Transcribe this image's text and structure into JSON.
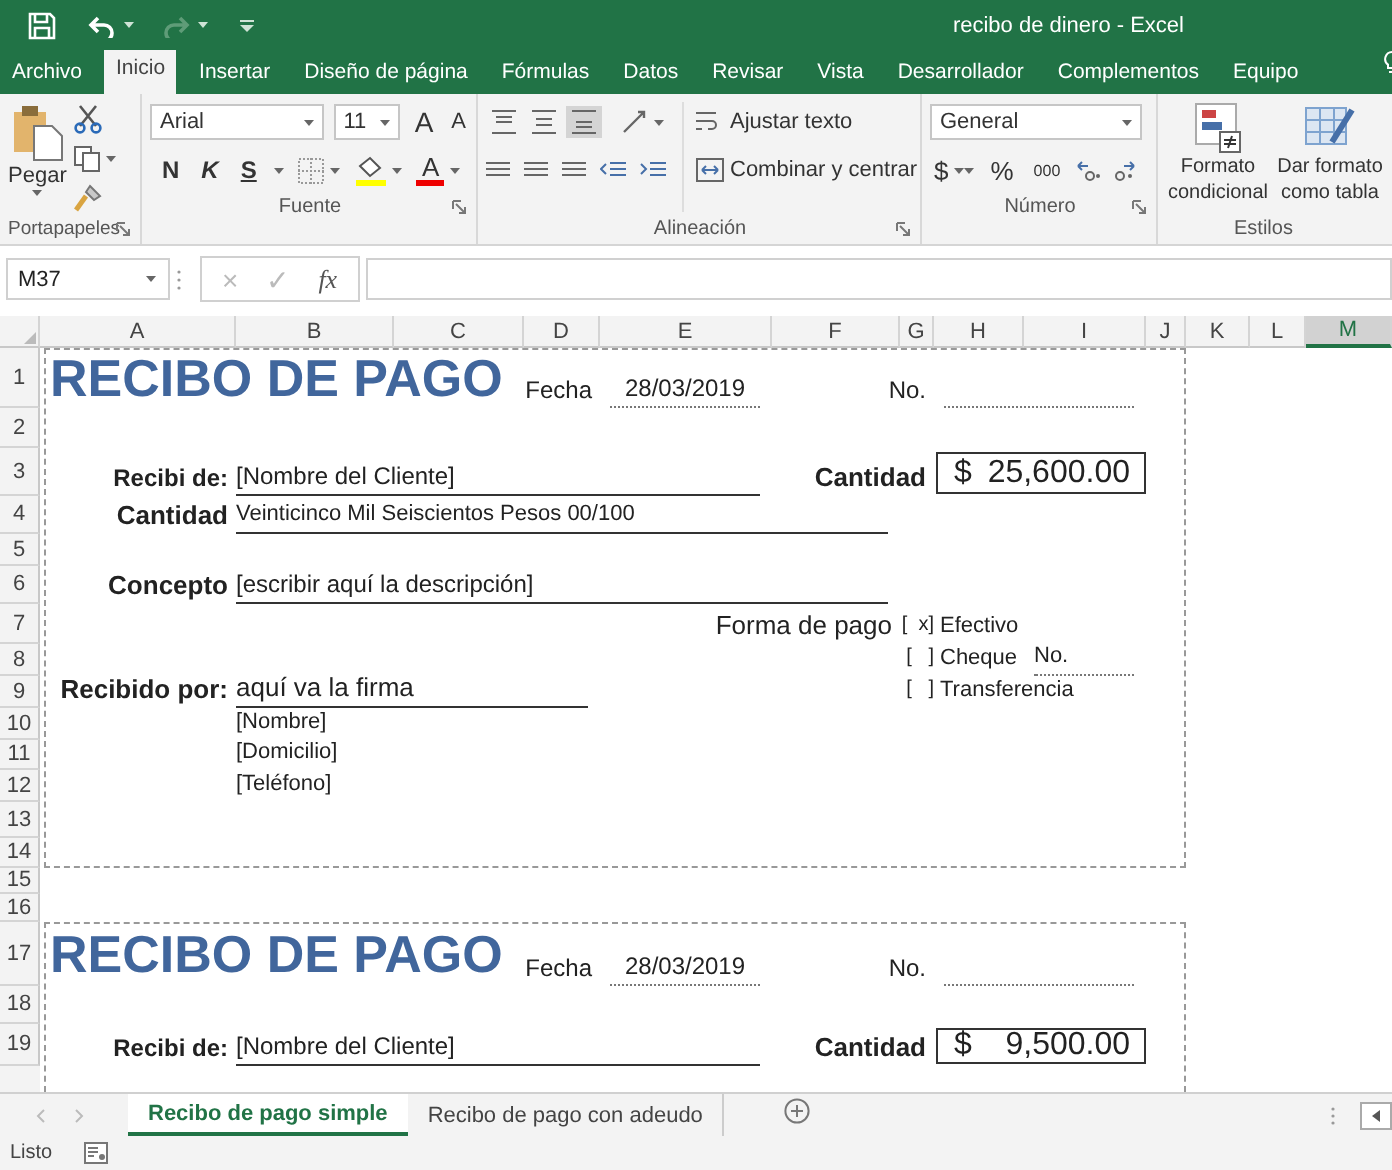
{
  "window": {
    "title": "recibo de dinero - Excel"
  },
  "menu_tabs": [
    {
      "label": "Archivo",
      "selected": false
    },
    {
      "label": "Inicio",
      "selected": true
    },
    {
      "label": "Insertar",
      "selected": false
    },
    {
      "label": "Diseño de página",
      "selected": false
    },
    {
      "label": "Fórmulas",
      "selected": false
    },
    {
      "label": "Datos",
      "selected": false
    },
    {
      "label": "Revisar",
      "selected": false
    },
    {
      "label": "Vista",
      "selected": false
    },
    {
      "label": "Desarrollador",
      "selected": false
    },
    {
      "label": "Complementos",
      "selected": false
    },
    {
      "label": "Equipo",
      "selected": false
    }
  ],
  "ribbon": {
    "clipboard": {
      "paste": "Pegar",
      "group": "Portapapeles"
    },
    "font": {
      "name": "Arial",
      "size": "11",
      "grow": "A",
      "shrink": "A",
      "styles": [
        "N",
        "K",
        "S"
      ],
      "font_color": "A",
      "group": "Fuente"
    },
    "alignment": {
      "vertical_align": [
        {
          "selected": false
        },
        {
          "selected": false
        },
        {
          "selected": true
        }
      ],
      "wrap": "Ajustar texto",
      "merge": "Combinar y centrar",
      "group": "Alineación"
    },
    "number": {
      "format": "General",
      "currency": "$",
      "percent": "%",
      "thousands": "000",
      "group": "Número"
    },
    "styles": {
      "buttons": [
        "Formato condicional",
        "Dar formato como tabla"
      ],
      "group": "Estilos"
    }
  },
  "formula_bar": {
    "name_box": "M37",
    "cancel": "×",
    "enter": "✓",
    "function": "fx"
  },
  "columns": [
    {
      "label": "A",
      "selected": false
    },
    {
      "label": "B",
      "selected": false
    },
    {
      "label": "C",
      "selected": false
    },
    {
      "label": "D",
      "selected": false
    },
    {
      "label": "E",
      "selected": false
    },
    {
      "label": "F",
      "selected": false
    },
    {
      "label": "G",
      "selected": false
    },
    {
      "label": "H",
      "selected": false
    },
    {
      "label": "I",
      "selected": false
    },
    {
      "label": "J",
      "selected": false
    },
    {
      "label": "K",
      "selected": false
    },
    {
      "label": "L",
      "selected": false
    },
    {
      "label": "M",
      "selected": true
    }
  ],
  "rows": [
    "1",
    "2",
    "3",
    "4",
    "5",
    "6",
    "7",
    "8",
    "9",
    "10",
    "11",
    "12",
    "13",
    "14",
    "15",
    "16",
    "17",
    "18",
    "19"
  ],
  "receipts": [
    {
      "title": "RECIBO DE PAGO",
      "date_label": "Fecha",
      "date": "28/03/2019",
      "number_label": "No.",
      "from_label": "Recibi de:",
      "from": "[Nombre del Cliente]",
      "amount_label": "Cantidad",
      "currency": "$",
      "amount": "25,600.00",
      "words_label": "Cantidad",
      "words": "Veinticinco Mil Seiscientos Pesos 00/100",
      "concept_label": "Concepto",
      "concept": "[escribir aquí la descripción]",
      "payment_label": "Forma de pago",
      "payment_options": [
        {
          "box": "[  x]",
          "label": "Efectivo"
        },
        {
          "box": "[   ]",
          "label": "Cheque",
          "field_label": "No."
        },
        {
          "box": "[   ]",
          "label": "Transferencia"
        }
      ],
      "received_label": "Recibido por:",
      "signature": "aquí va la firma",
      "details": [
        "[Nombre]",
        "[Domicilio]",
        "[Teléfono]"
      ]
    },
    {
      "title": "RECIBO DE PAGO",
      "date_label": "Fecha",
      "date": "28/03/2019",
      "number_label": "No.",
      "from_label": "Recibi de:",
      "from": "[Nombre del Cliente]",
      "amount_label": "Cantidad",
      "currency": "$",
      "amount": "9,500.00"
    }
  ],
  "sheet_tabs": [
    {
      "label": "Recibo de pago simple",
      "selected": true
    },
    {
      "label": "Recibo de pago con adeudo",
      "selected": false
    }
  ],
  "status_bar": {
    "text": "Listo"
  }
}
